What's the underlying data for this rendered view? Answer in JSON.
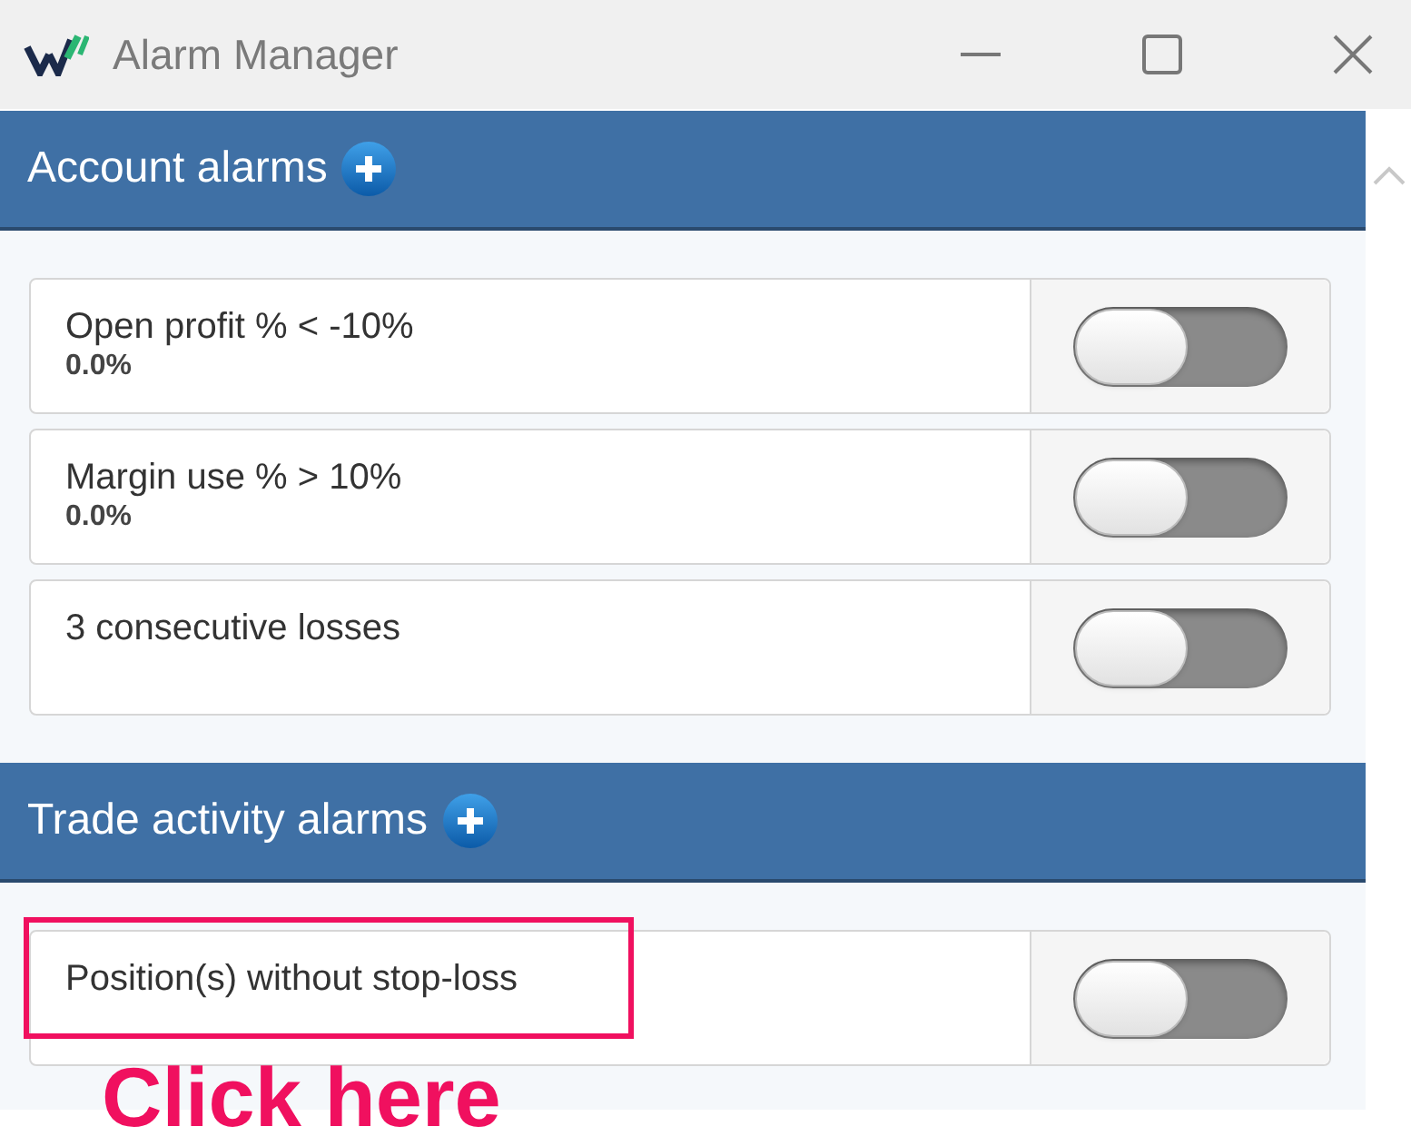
{
  "window": {
    "title": "Alarm Manager"
  },
  "sections": [
    {
      "title": "Account alarms",
      "alarms": [
        {
          "label": "Open profit % < -10%",
          "value": "0.0%",
          "on": false
        },
        {
          "label": "Margin use % > 10%",
          "value": "0.0%",
          "on": false
        },
        {
          "label": "3 consecutive losses",
          "on": false
        }
      ]
    },
    {
      "title": "Trade activity alarms",
      "alarms": [
        {
          "label": "Position(s) without stop-loss",
          "on": false
        }
      ]
    }
  ],
  "annotation": {
    "text": "Click here"
  }
}
